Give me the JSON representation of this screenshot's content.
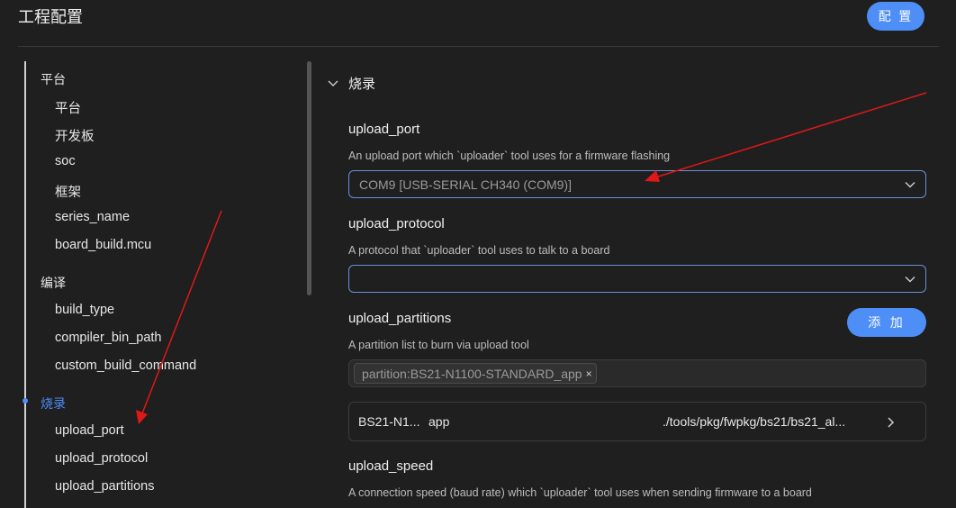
{
  "header": {
    "title": "工程配置",
    "config_button": "配 置"
  },
  "sidebar": {
    "groups": [
      {
        "label": "平台",
        "items": [
          "平台",
          "开发板",
          "soc",
          "框架",
          "series_name",
          "board_build.mcu"
        ]
      },
      {
        "label": "编译",
        "items": [
          "build_type",
          "compiler_bin_path",
          "custom_build_command"
        ]
      },
      {
        "label": "烧录",
        "items": [
          "upload_port",
          "upload_protocol",
          "upload_partitions"
        ]
      }
    ],
    "active_group": "烧录"
  },
  "section": {
    "title": "烧录"
  },
  "fields": {
    "upload_port": {
      "label": "upload_port",
      "description": "An upload port which `uploader` tool uses for a firmware flashing",
      "value": "COM9 [USB-SERIAL CH340 (COM9)]"
    },
    "upload_protocol": {
      "label": "upload_protocol",
      "description": "A protocol that `uploader` tool uses to talk to a board",
      "value": ""
    },
    "upload_partitions": {
      "label": "upload_partitions",
      "description": "A partition list to burn via upload tool",
      "add_button": "添 加",
      "tag": "partition:BS21-N1100-STANDARD_app",
      "tag_close": "×",
      "row": {
        "name": "BS21-N1...",
        "type": "app",
        "path": "./tools/pkg/fwpkg/bs21/bs21_al..."
      }
    },
    "upload_speed": {
      "label": "upload_speed",
      "description": "A connection speed (baud rate) which `uploader` tool uses when sending firmware to a board"
    }
  },
  "colors": {
    "background": "#1f1f1f",
    "accent": "#4d8ef7",
    "annotation_arrow": "#e01818"
  }
}
